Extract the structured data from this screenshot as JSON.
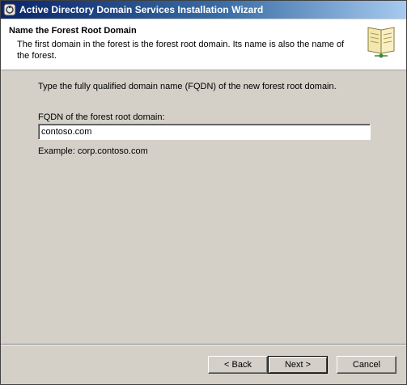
{
  "window": {
    "title": "Active Directory Domain Services Installation Wizard"
  },
  "header": {
    "title": "Name the Forest Root Domain",
    "description": "The first domain in the forest is the forest root domain. Its name is also the name of the forest."
  },
  "body": {
    "instruction": "Type the fully qualified domain name (FQDN) of the new forest root domain.",
    "fqdn_label": "FQDN of the forest root domain:",
    "fqdn_value": "contoso.com",
    "example": "Example: corp.contoso.com"
  },
  "buttons": {
    "back": "< Back",
    "next": "Next >",
    "cancel": "Cancel"
  },
  "icons": {
    "title": "ad-wizard-icon",
    "header": "book-icon"
  },
  "colors": {
    "titlebar_start": "#0a246a",
    "titlebar_end": "#a6caf0",
    "dialog_bg": "#d4d0c8"
  }
}
